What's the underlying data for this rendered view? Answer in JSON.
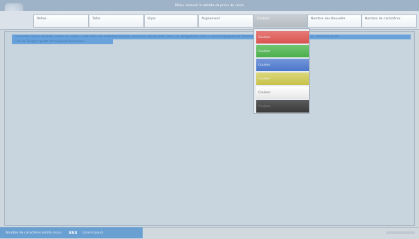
{
  "window": {
    "title": "Milieu recevoir la retraite de prime de raisin"
  },
  "ribbon": {
    "tabs": [
      {
        "label": "Refixe"
      },
      {
        "label": "Taille"
      },
      {
        "label": "Style"
      },
      {
        "label": "Alignement"
      },
      {
        "label": "Couleur"
      },
      {
        "label": "Nombre des Nouvelle"
      },
      {
        "label": "Nombre de caractères"
      }
    ],
    "active_tab": "Couleur"
  },
  "editor": {
    "line1": "Leonardo chose foamed, oratio un sinter, usdo fimo mo mobilum aumqu, conclusa nai leviorer, lacer un dirigament cum a cour l'engagement l'harmonieuse que, instrumentum, que sinter, concluez quies",
    "line2": "Cellule Tonight quota est toujours-boisseaux"
  },
  "color_menu": {
    "items": [
      {
        "label": "Couleur",
        "color": "#d9534f"
      },
      {
        "label": "Couleur",
        "color": "#4cae4c"
      },
      {
        "label": "Couleur",
        "color": "#4a76c9"
      },
      {
        "label": "Couleur",
        "color": "#c8c24a"
      },
      {
        "label": "Couleur",
        "color": "#f2f2f2"
      },
      {
        "label": "Couleur",
        "color": "#3a3a3a"
      }
    ]
  },
  "statusbar": {
    "label": "Nombre de caractères entrés maxi :",
    "count": "353",
    "suffix": "Lorem Ipsum"
  }
}
